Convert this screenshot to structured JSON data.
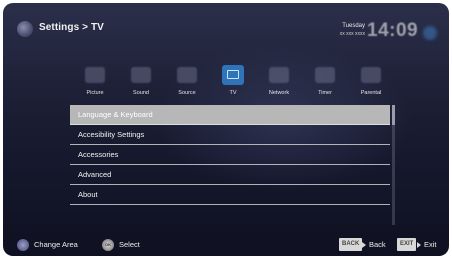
{
  "header": {
    "breadcrumb": "Settings > TV",
    "day": "Tuesday",
    "date": "xx xxx xxxx",
    "time": "14:09"
  },
  "categories": [
    {
      "label": "Picture",
      "icon": "picture-icon",
      "active": false
    },
    {
      "label": "Sound",
      "icon": "sound-icon",
      "active": false
    },
    {
      "label": "Source",
      "icon": "source-icon",
      "active": false
    },
    {
      "label": "TV",
      "icon": "tv-icon",
      "active": true
    },
    {
      "label": "Network",
      "icon": "network-icon",
      "active": false
    },
    {
      "label": "Timer",
      "icon": "timer-icon",
      "active": false
    },
    {
      "label": "Parental",
      "icon": "parental-icon",
      "active": false
    }
  ],
  "menu": {
    "items": [
      {
        "label": "Language & Keyboard",
        "selected": true
      },
      {
        "label": "Accesibility Settings",
        "selected": false
      },
      {
        "label": "Accessories",
        "selected": false
      },
      {
        "label": "Advanced",
        "selected": false
      },
      {
        "label": "About",
        "selected": false
      }
    ]
  },
  "footer": {
    "change_area": "Change Area",
    "ok_key": "OK",
    "select": "Select",
    "back_key": "BACK",
    "back": "Back",
    "exit_key": "EXIT",
    "exit": "Exit"
  },
  "colors": {
    "background": "#1d2036",
    "active_tab": "#2f74b8",
    "selected_row": "#b7b7b7"
  }
}
